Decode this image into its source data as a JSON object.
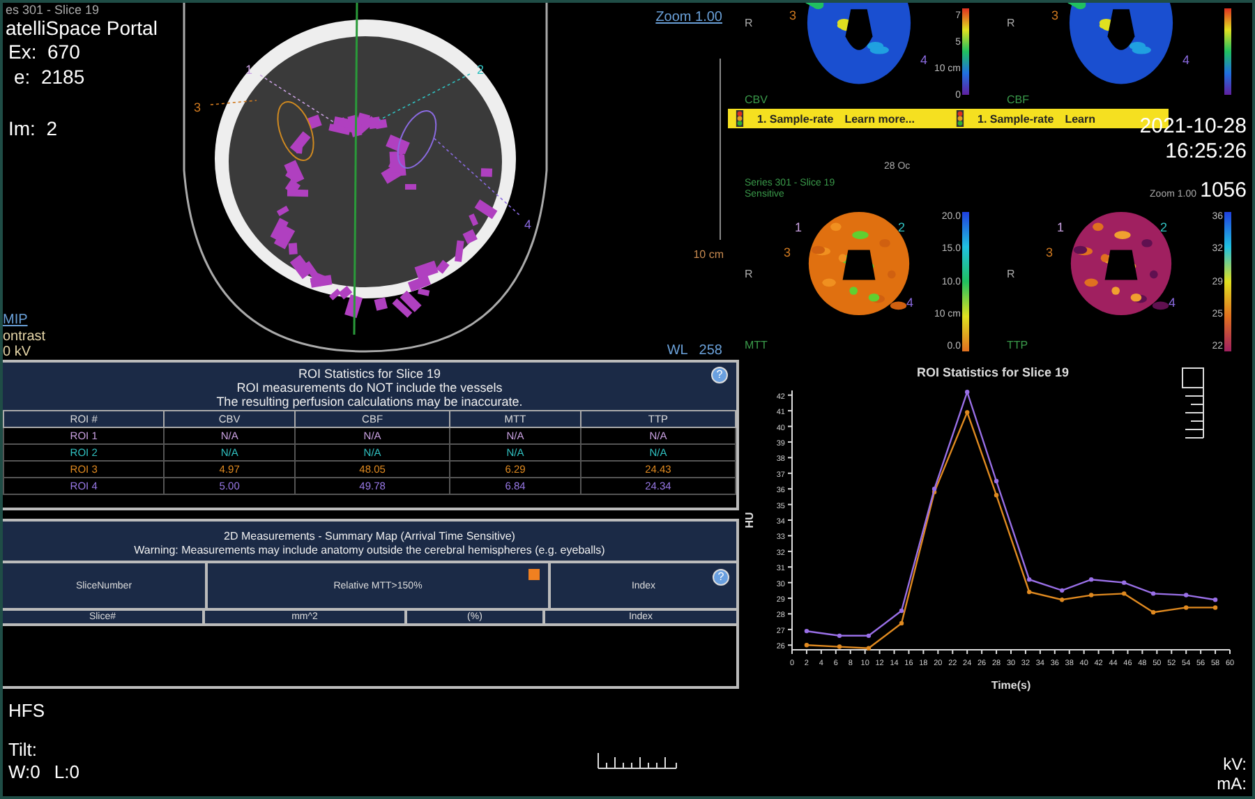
{
  "viewer": {
    "series": "es 301 - Slice 19",
    "app_title": "atelliSpace Portal",
    "ex": "Ex:  670",
    "se": "e:  2185",
    "im": "Im:  2",
    "zoom": "Zoom 1.00",
    "scale": "10 cm",
    "mode": "MIP",
    "contrast": "ontrast",
    "kv": "0 kV",
    "wl": "WL   258",
    "rois": [
      {
        "label": "1",
        "color": "#c8a0e0"
      },
      {
        "label": "2",
        "color": "#30c0c0"
      },
      {
        "label": "3",
        "color": "#d07a20"
      },
      {
        "label": "4",
        "color": "#8a6ae0"
      }
    ]
  },
  "maps": [
    {
      "name": "CBV",
      "orientation": "R",
      "kind": "rainbow",
      "scale": [
        "7",
        "5",
        "10 cm",
        "0"
      ],
      "roi_labels": [
        {
          "label": "3",
          "color": "#d07a20"
        },
        {
          "label": "4",
          "color": "#8a6ae0"
        }
      ]
    },
    {
      "name": "CBF",
      "orientation": "R",
      "kind": "rainbow",
      "roi_labels": [
        {
          "label": "3",
          "color": "#d07a20"
        },
        {
          "label": "4",
          "color": "#8a6ae0"
        }
      ]
    },
    {
      "name": "MTT",
      "orientation": "R",
      "kind": "orange",
      "scale": [
        "20.0",
        "15.0",
        "10.0",
        "10 cm",
        "0.0"
      ],
      "roi_labels": [
        {
          "label": "1",
          "color": "#c8a0e0"
        },
        {
          "label": "2",
          "color": "#30c0c0"
        },
        {
          "label": "3",
          "color": "#d07a20"
        },
        {
          "label": "4",
          "color": "#8a6ae0"
        }
      ]
    },
    {
      "name": "TTP",
      "orientation": "R",
      "kind": "heat",
      "scale": [
        "36",
        "32",
        "29",
        "25",
        "22"
      ],
      "roi_labels": [
        {
          "label": "1",
          "color": "#c8a0e0"
        },
        {
          "label": "2",
          "color": "#30c0c0"
        },
        {
          "label": "3",
          "color": "#d07a20"
        },
        {
          "label": "4",
          "color": "#8a6ae0"
        }
      ]
    }
  ],
  "banner": {
    "items": [
      {
        "step": "1. Sample-rate",
        "link": "Learn more..."
      },
      {
        "step": "1. Sample-rate",
        "link": "Learn"
      }
    ]
  },
  "overlay": {
    "date": "2021-10-28",
    "time": "16:25:26",
    "series_info": "Series 301 - Slice 19",
    "sensitivity": "Sensitive",
    "date_fragment": "28 Oc",
    "zoom": "Zoom 1.00",
    "value": "1056"
  },
  "roi_table": {
    "title_lines": [
      "ROI Statistics for Slice 19",
      "ROI measurements do NOT include the vessels",
      "The resulting perfusion calculations may be inaccurate."
    ],
    "help_icon": "?",
    "columns": [
      "ROI #",
      "CBV",
      "CBF",
      "MTT",
      "TTP"
    ],
    "rows": [
      {
        "color": "#c8a0e0",
        "cells": [
          "ROI 1",
          "N/A",
          "N/A",
          "N/A",
          "N/A"
        ]
      },
      {
        "color": "#30c0c0",
        "cells": [
          "ROI 2",
          "N/A",
          "N/A",
          "N/A",
          "N/A"
        ]
      },
      {
        "color": "#e08a20",
        "cells": [
          "ROI 3",
          "4.97",
          "48.05",
          "6.29",
          "24.43"
        ]
      },
      {
        "color": "#9a7ae8",
        "cells": [
          "ROI 4",
          "5.00",
          "49.78",
          "6.84",
          "24.34"
        ]
      }
    ]
  },
  "measurements": {
    "title_lines": [
      "2D Measurements - Summary Map (Arrival Time Sensitive)",
      "Warning: Measurements may include anatomy outside the cerebral hemispheres (e.g. eyeballs)"
    ],
    "headers": [
      "SliceNumber",
      "Relative MTT>150%",
      "Index"
    ],
    "help_icon": "?",
    "subheaders": [
      "Slice#",
      "mm^2",
      "(%)",
      "Index"
    ]
  },
  "chart": {
    "chart_data": {
      "type": "line",
      "title": "ROI Statistics for Slice 19",
      "xlabel": "Time(s)",
      "ylabel": "HU",
      "x": [
        2,
        6.5,
        10.5,
        15,
        19.5,
        24,
        28,
        32.5,
        37,
        41,
        45.5,
        49.5,
        54,
        58
      ],
      "series": [
        {
          "color": "#e08a20",
          "marker": true,
          "values": [
            26.0,
            25.9,
            25.8,
            27.4,
            35.8,
            40.9,
            35.6,
            29.4,
            28.9,
            29.2,
            29.3,
            28.1,
            28.4,
            28.4
          ]
        },
        {
          "color": "#9a70e8",
          "marker": true,
          "values": [
            26.9,
            26.6,
            26.6,
            28.2,
            36.0,
            42.2,
            36.5,
            30.2,
            29.5,
            30.2,
            30.0,
            29.3,
            29.2,
            28.9
          ]
        }
      ],
      "xlim": [
        0,
        60
      ],
      "ylim": [
        25.7,
        42.3
      ],
      "xticks": [
        0,
        2,
        4,
        6,
        8,
        10,
        12,
        14,
        16,
        18,
        20,
        22,
        24,
        26,
        28,
        30,
        32,
        34,
        36,
        38,
        40,
        42,
        44,
        46,
        48,
        50,
        52,
        54,
        56,
        58,
        60
      ],
      "yticks": [
        26,
        27,
        28,
        29,
        30,
        31,
        32,
        33,
        34,
        35,
        36,
        37,
        38,
        39,
        40,
        41,
        42
      ]
    }
  },
  "footer": {
    "position": "HFS",
    "tilt": "Tilt:",
    "window": "W:0",
    "level": "L:0",
    "kv": "kV:",
    "ma": "mA:"
  }
}
